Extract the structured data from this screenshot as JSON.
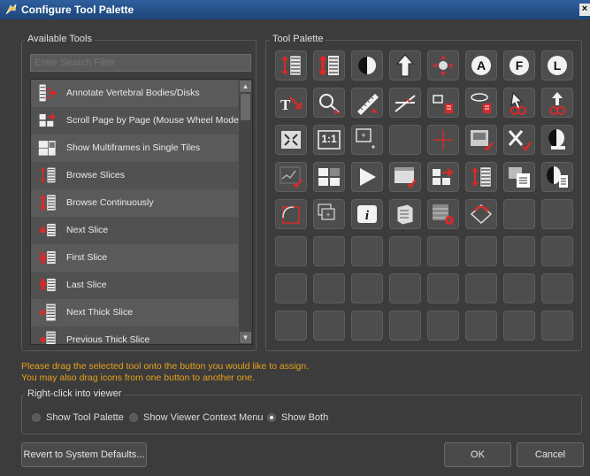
{
  "window": {
    "title": "Configure Tool Palette",
    "close_symbol": "×"
  },
  "available_tools": {
    "title": "Available Tools",
    "search_placeholder": "Enter Search Filter",
    "items": [
      {
        "label": "Annotate Vertebral Bodies/Disks",
        "icon": "vertebral-annotate-icon"
      },
      {
        "label": "Scroll Page by Page (Mouse Wheel Mode)",
        "icon": "scroll-page-icon"
      },
      {
        "label": "Show Multiframes in Single Tiles",
        "icon": "multiframe-tiles-icon"
      },
      {
        "label": "Browse Slices",
        "icon": "browse-slices-icon"
      },
      {
        "label": "Browse Continuously",
        "icon": "browse-continuously-icon"
      },
      {
        "label": "Next Slice",
        "icon": "next-slice-icon"
      },
      {
        "label": "First Slice",
        "icon": "first-slice-icon"
      },
      {
        "label": "Last Slice",
        "icon": "last-slice-icon"
      },
      {
        "label": "Next Thick Slice",
        "icon": "next-thick-slice-icon"
      },
      {
        "label": "Previous Thick Slice",
        "icon": "previous-thick-slice-icon"
      }
    ]
  },
  "tool_palette": {
    "title": "Tool Palette",
    "slots": [
      "browse-slices-icon",
      "browse-continuously-icon",
      "window-level-icon",
      "pan-icon",
      "move-icon",
      "circle-a-icon",
      "circle-f-icon",
      "circle-l-icon",
      "text-arrow-icon",
      "zoom-loupe-icon",
      "ruler-icon",
      "angle-icon",
      "roi-rect-icon",
      "roi-ellipse-icon",
      "link-pointer-icon",
      "link-arrow-icon",
      "fit-icon",
      "one-to-one-label",
      "zoom-box-icon",
      "empty",
      "crosshair-icon",
      "image-check-icon",
      "delete-x-icon",
      "half-contrast-icon",
      "curve-check-icon",
      "multiframe-icon",
      "play-icon",
      "image-checkmark-icon",
      "scroll-page-icon",
      "browse-slices-icon",
      "layout-icon",
      "contrast-doc-icon",
      "region-select-icon",
      "stack-icon",
      "info-icon",
      "layers-icon",
      "settings-icon",
      "rotate-icon",
      "empty",
      "empty",
      "empty",
      "empty",
      "empty",
      "empty",
      "empty",
      "empty",
      "empty",
      "empty",
      "empty",
      "empty",
      "empty",
      "empty",
      "empty",
      "empty",
      "empty",
      "empty",
      "empty",
      "empty",
      "empty",
      "empty",
      "empty",
      "empty",
      "empty",
      "empty"
    ],
    "one_to_one_text": "1:1"
  },
  "hint": {
    "line1": "Please drag the selected tool onto the button you would like to assign.",
    "line2": "You may also drag icons from one button to another one."
  },
  "right_click": {
    "title": "Right-click into viewer",
    "options": [
      {
        "label": "Show Tool Palette",
        "selected": false
      },
      {
        "label": "Show Viewer Context Menu",
        "selected": false
      },
      {
        "label": "Show Both",
        "selected": true
      }
    ]
  },
  "buttons": {
    "revert": "Revert to System Defaults...",
    "ok": "OK",
    "cancel": "Cancel"
  },
  "colors": {
    "accent_red": "#d62a2a",
    "hint_orange": "#e8a21a",
    "title_blue": "#2a5a96"
  }
}
